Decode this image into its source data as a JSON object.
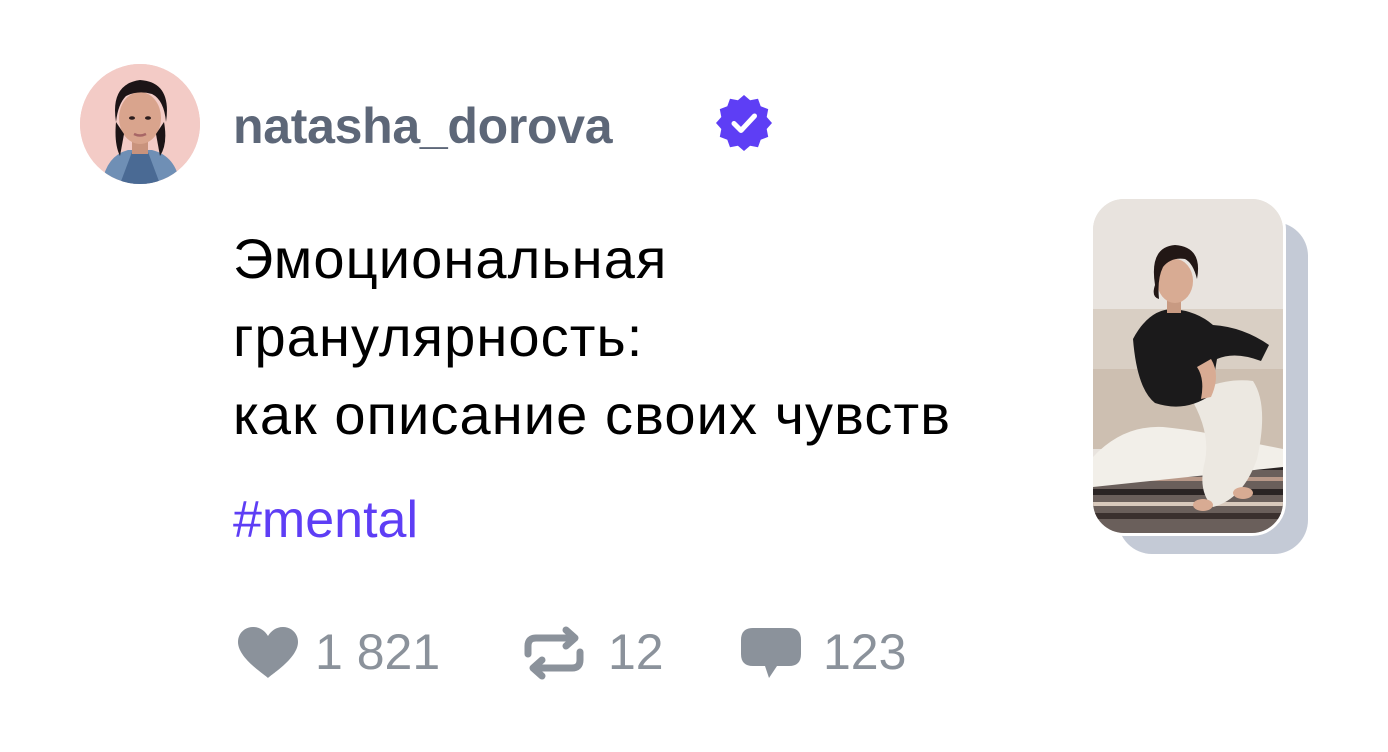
{
  "post": {
    "author": {
      "username": "natasha_dorova",
      "avatar_icon": "avatar-photo",
      "verified": true,
      "verified_icon": "verified-badge-icon"
    },
    "title_lines": [
      "Эмоциональная",
      "гранулярность:",
      "как описание своих чувств"
    ],
    "hashtag": "#mental",
    "image_icon": "post-photo",
    "stats": {
      "likes": "1 821",
      "reposts": "12",
      "comments": "123"
    }
  },
  "colors": {
    "accent": "#5e3ef5",
    "username": "#5d6778",
    "stat_gray": "#8b929b",
    "photo_shadow": "#c4cad6"
  }
}
